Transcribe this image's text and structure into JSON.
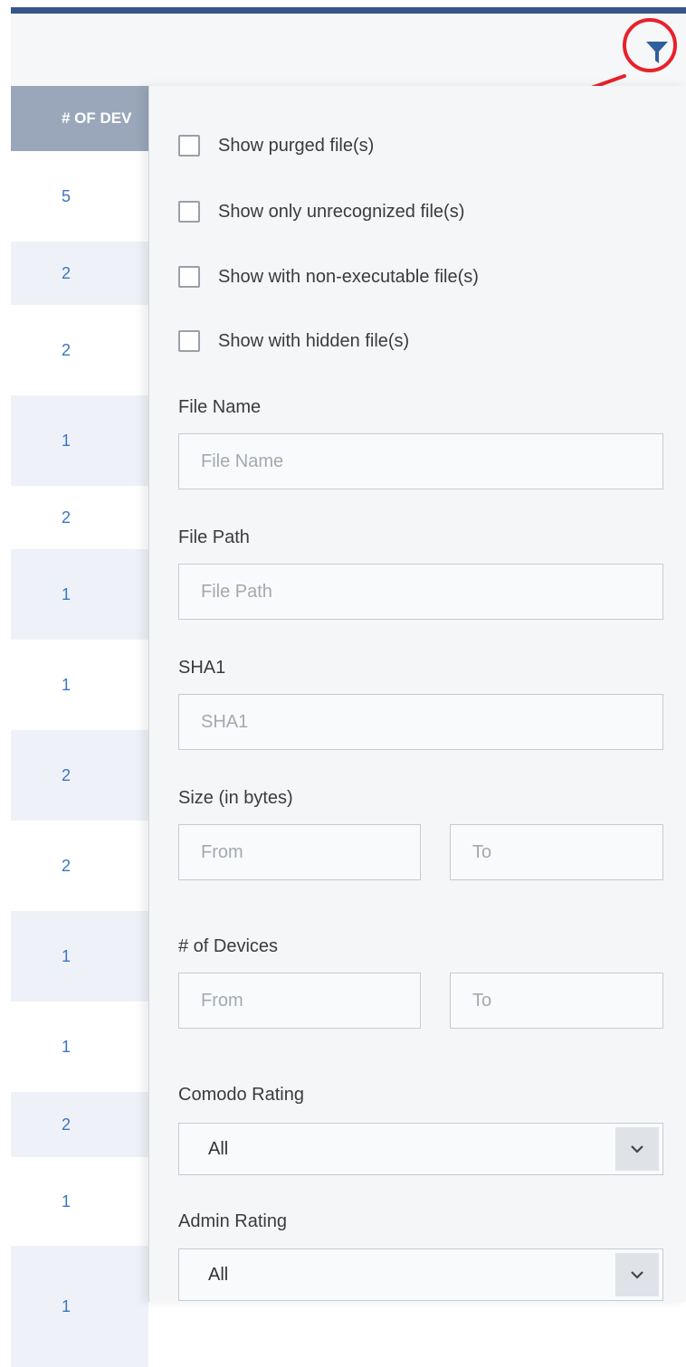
{
  "table": {
    "column_header": "# OF DEV",
    "rows": [
      "5",
      "2",
      "2",
      "1",
      "2",
      "1",
      "1",
      "2",
      "2",
      "1",
      "1",
      "2",
      "1",
      "1"
    ]
  },
  "toolbar": {
    "filter_icon": "filter-funnel-icon"
  },
  "filter_panel": {
    "checkboxes": [
      "Show purged file(s)",
      "Show only unrecognized file(s)",
      "Show with non-executable file(s)",
      "Show with hidden file(s)"
    ],
    "file_name": {
      "label": "File Name",
      "placeholder": "File Name"
    },
    "file_path": {
      "label": "File Path",
      "placeholder": "File Path"
    },
    "sha1": {
      "label": "SHA1",
      "placeholder": "SHA1"
    },
    "size": {
      "label": "Size (in bytes)",
      "from_placeholder": "From",
      "to_placeholder": "To"
    },
    "devices": {
      "label": "# of Devices",
      "from_placeholder": "From",
      "to_placeholder": "To"
    },
    "comodo_rating": {
      "label": "Comodo Rating",
      "value": "All"
    },
    "admin_rating": {
      "label": "Admin Rating",
      "value": "All"
    }
  },
  "colors": {
    "accent": "#36558a",
    "link": "#3a76c4",
    "annotation": "#e8212a",
    "header_bg": "#9aa7ba"
  }
}
